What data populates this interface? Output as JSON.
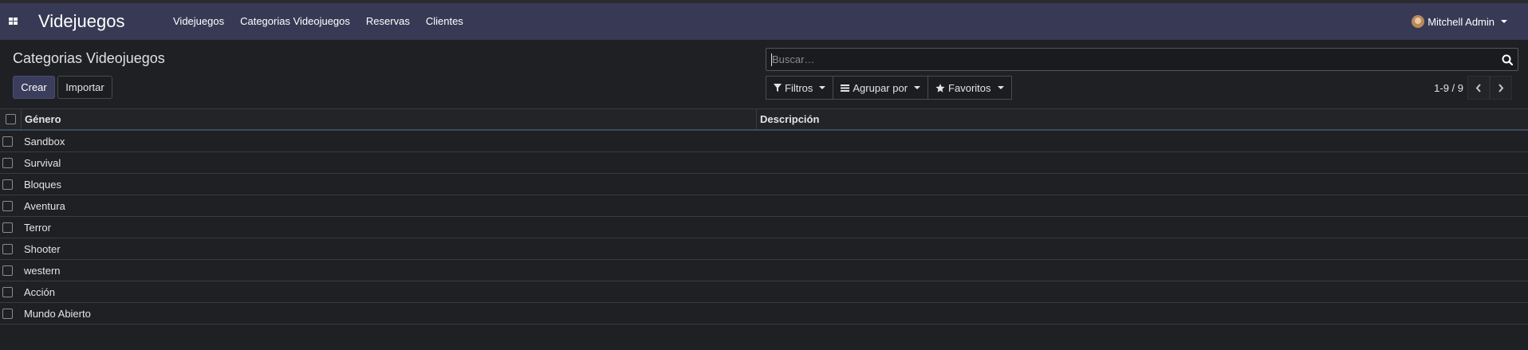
{
  "navbar": {
    "app_icon": "apps-grid-icon",
    "brand": "Videjuegos",
    "menu": [
      {
        "label": "Videjuegos"
      },
      {
        "label": "Categorias Videojuegos"
      },
      {
        "label": "Reservas"
      },
      {
        "label": "Clientes"
      }
    ],
    "user": "Mitchell Admin"
  },
  "control_panel": {
    "breadcrumb": "Categorias Videojuegos",
    "create_label": "Crear",
    "import_label": "Importar",
    "search": {
      "placeholder": "Buscar…",
      "value": ""
    },
    "filters_label": "Filtros",
    "groupby_label": "Agrupar por",
    "favorites_label": "Favoritos",
    "pager": "1-9 / 9"
  },
  "table": {
    "columns": [
      "Género",
      "Descripción"
    ],
    "rows": [
      {
        "genero": "Sandbox",
        "descripcion": ""
      },
      {
        "genero": "Survival",
        "descripcion": ""
      },
      {
        "genero": "Bloques",
        "descripcion": ""
      },
      {
        "genero": "Aventura",
        "descripcion": ""
      },
      {
        "genero": "Terror",
        "descripcion": ""
      },
      {
        "genero": "Shooter",
        "descripcion": ""
      },
      {
        "genero": "western",
        "descripcion": ""
      },
      {
        "genero": "Acción",
        "descripcion": ""
      },
      {
        "genero": "Mundo Abierto",
        "descripcion": ""
      }
    ]
  },
  "colors": {
    "navbar_bg": "#383a55",
    "body_bg": "#1f2023",
    "primary_button": "#3b3d5c"
  }
}
